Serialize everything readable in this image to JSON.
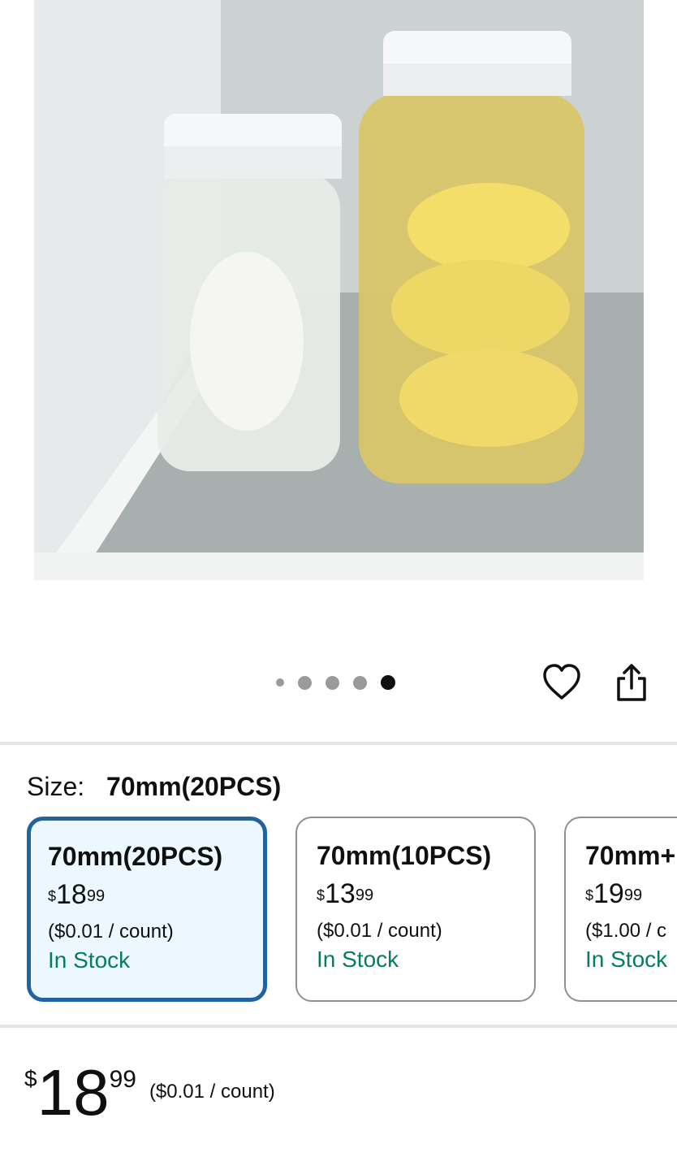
{
  "product_image": {
    "alt": "Two mason jars with white plastic lids in a refrigerator"
  },
  "carousel": {
    "dot_count": 5,
    "active_index": 4
  },
  "actions": {
    "wishlist_icon": "heart-icon",
    "share_icon": "share-icon"
  },
  "size": {
    "label": "Size:",
    "selected_value": "70mm(20PCS)"
  },
  "options": [
    {
      "name": "70mm(20PCS)",
      "currency": "$",
      "price_whole": "18",
      "price_cents": "99",
      "unit_price": "($0.01 / count)",
      "stock": "In Stock",
      "selected": true
    },
    {
      "name": "70mm(10PCS)",
      "currency": "$",
      "price_whole": "13",
      "price_cents": "99",
      "unit_price": "($0.01 / count)",
      "stock": "In Stock",
      "selected": false
    },
    {
      "name": "70mm+",
      "currency": "$",
      "price_whole": "19",
      "price_cents": "99",
      "unit_price": "($1.00 / c",
      "stock": "In Stock",
      "selected": false
    }
  ],
  "price": {
    "currency": "$",
    "whole": "18",
    "cents": "99",
    "unit_price": "($0.01 / count)"
  },
  "colors": {
    "selected_border": "#2162a1",
    "selected_bg": "#edf7ff",
    "in_stock": "#067d62"
  }
}
